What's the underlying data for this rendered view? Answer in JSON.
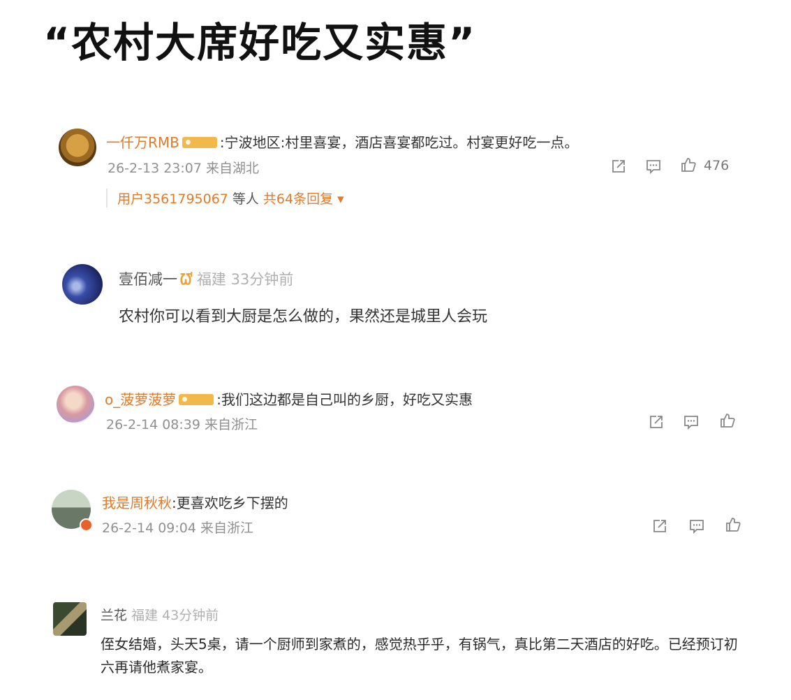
{
  "headline": "“农村大席好吃又实惠”",
  "icons": {
    "share": "share-icon",
    "comment": "comment-icon",
    "like": "thumbs-up-icon"
  },
  "comments": [
    {
      "username": "一仟万RMB",
      "text": ":宁波地区:村里喜宴，酒店喜宴都吃过。村宴更好吃一点。",
      "time": "26-2-13 23:07",
      "location": "来自湖北",
      "likes": "476",
      "replies": {
        "users": "用户3561795067",
        "others": "等人",
        "count": "共64条回复",
        "arrow": "▾"
      }
    },
    {
      "username": "壹佰减一",
      "vip": "ᘺ",
      "region": "福建",
      "ago": "33分钟前",
      "text": "农村你可以看到大厨是怎么做的，果然还是城里人会玩"
    },
    {
      "username": "o_菠萝菠萝",
      "text": ":我们这边都是自己叫的乡厨，好吃又实惠",
      "time": "26-2-14 08:39",
      "location": "来自浙江"
    },
    {
      "username": "我是周秋秋",
      "text": ":更喜欢吃乡下摆的",
      "time": "26-2-14 09:04",
      "location": "来自浙江"
    },
    {
      "username": "兰花",
      "region": "福建",
      "ago": "43分钟前",
      "text": "侄女结婚，头天5桌，请一个厨师到家煮的，感觉热乎乎，有锅气，真比第二天酒店的好吃。已经预订初六再请他煮家宴。"
    }
  ]
}
